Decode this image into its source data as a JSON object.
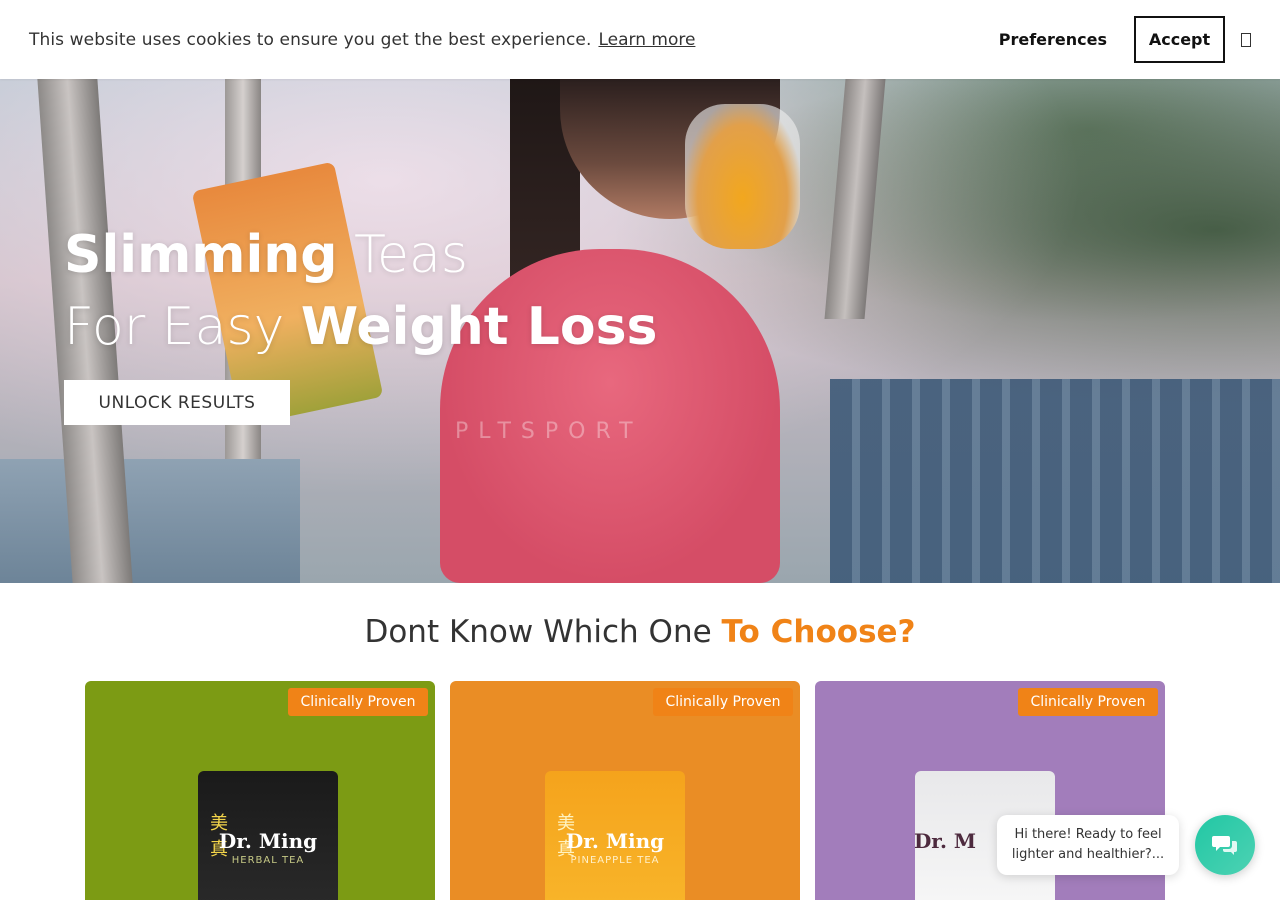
{
  "cookie": {
    "message": "This website uses cookies to ensure you get the best experience.",
    "learn_more": "Learn more",
    "preferences": "Preferences",
    "accept": "Accept"
  },
  "hero": {
    "line1_bold": "Slimming",
    "line1_light": " Teas",
    "line2_light": "For Easy ",
    "line2_bold": "Weight Loss",
    "cta": "UNLOCK RESULTS",
    "shirt_text": "PLTSPORT"
  },
  "section": {
    "title_plain": "Dont Know Which One ",
    "title_accent": "To Choose?"
  },
  "cards": [
    {
      "badge": "Clinically Proven",
      "brand": "Dr. Ming",
      "sub": "HERBAL TEA",
      "color": "#7c9b14"
    },
    {
      "badge": "Clinically Proven",
      "brand": "Dr. Ming",
      "sub": "PINEAPPLE TEA",
      "color": "#ea8d25"
    },
    {
      "badge": "Clinically Proven",
      "brand": "Dr. M",
      "sub": "",
      "color": "#a27dbb"
    }
  ],
  "chat": {
    "message": "Hi there! Ready to feel lighter and healthier?..."
  },
  "colors": {
    "accent": "#f08317",
    "chat": "#21c7a4"
  }
}
